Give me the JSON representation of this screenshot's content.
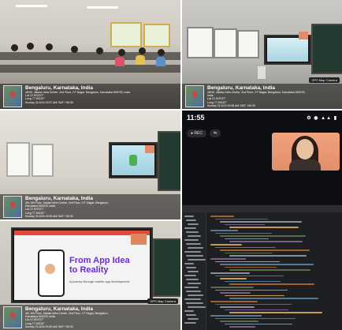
{
  "tiles": {
    "classroom_1": {
      "geo": {
        "city": "Bengaluru, Karnataka, India",
        "address_lines": [
          "48/49, Jalaian Infra Centre, 2nd Floor, J P Nagar, Bengaluru, Karnataka 560078, India",
          "Lat 12.907027°",
          "Long 77.59120°",
          "Sunday 21/4/24 09:37 AM GMT +05:30"
        ]
      }
    },
    "classroom_2": {
      "geo": {
        "city": "Bengaluru, Karnataka, India",
        "address_lines": [
          "48/49, Jalaian Infra Centre, 2nd Floor, J P Nagar, Bengaluru, Karnataka 560078,",
          "India",
          "Lat 12.907027°",
          "Long 77.59120°",
          "Sunday 21/4/24 09:38 AM GMT +05:30"
        ],
        "badge": "GPS Map Camera"
      }
    },
    "classroom_3": {
      "geo": {
        "city": "Bengaluru, Karnataka, India",
        "address_lines": [
          "4th, 5th Floor, Jalaian Infra Centre, 2nd Floor, J.P. Nagar, Bengaluru,",
          "Karnataka 560078, India",
          "Lat 12.907027°",
          "Long 77.59120°",
          "Sunday 21/4/24 09:39 AM GMT +05:30"
        ]
      }
    },
    "phone_screen": {
      "status": {
        "time": "11:55",
        "icons": "⚙ ◉ ▲▲ ▮"
      },
      "chips": [
        "● REC",
        "⇆"
      ]
    },
    "classroom_4": {
      "slide": {
        "title_line1": "From App Idea",
        "title_line2": "to Reality",
        "subtitle": "A journey through mobile app development"
      },
      "geo": {
        "city": "Bengaluru, Karnataka, India",
        "address_lines": [
          "4th, 5th Floor, Jalaian Infra Centre, 2nd Floor, J P Nagar, Bengaluru,",
          "Karnataka 560078, India",
          "Lat 12.907027°",
          "Long 77.59120°",
          "Sunday 21/4/24 09:39 AM GMT +05:30"
        ],
        "badge": "GPS Map Camera"
      }
    }
  },
  "colors": {
    "slide_title": "#6c2bd9",
    "slide_topbar": "#e34a3b",
    "board": "#24392f",
    "phone_bg": "#0e0f12"
  },
  "icons": [
    "map-thumbnail-icon",
    "location-pin-icon",
    "record-icon",
    "swap-icon"
  ]
}
